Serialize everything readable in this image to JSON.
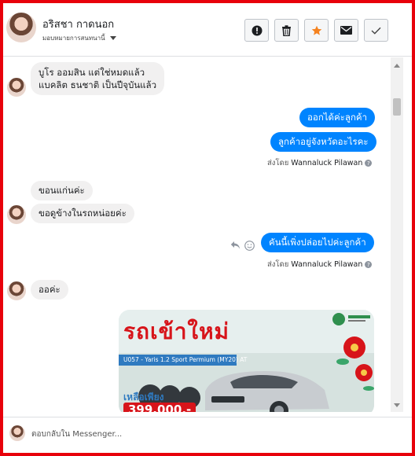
{
  "header": {
    "contact_name": "อริสชา กาดนอก",
    "assign_label": "มอบหมายการสนทนานี้",
    "tools": [
      "mark-spam",
      "delete",
      "star",
      "mark-unread",
      "done"
    ]
  },
  "messages": {
    "m1_line1": "บูโร ออมสิน แต่ใช่หมดแล้ว",
    "m1_line2": "แบคลิต ธนชาติ เป็นปีจุบันแล้ว",
    "m2": "ออกได้ค่ะลูกค้า",
    "m3": "ลูกค้าอยู่จังหวัดอะไรคะ",
    "sent_by_prefix": "ส่งโดย",
    "sent_by_name": "Wannaluck Pilawan",
    "m4": "ขอนแก่นค่ะ",
    "m5": "ขอดูข้างในรถหน่อยค่ะ",
    "m6": "คันนี้เพิ่งปล่อยไปค่ะลูกค้า",
    "m7": "ออค่ะ"
  },
  "car_promo": {
    "headline": "รถเข้าใหม่",
    "model": "U057 - Yaris 1.2 Sport Permium (MY20) AT",
    "price_label": "เหลือเพียง",
    "price": "399,000.-"
  },
  "footer": {
    "reply_placeholder": "ตอบกลับใน Messenger..."
  },
  "colors": {
    "frame": "#e8000b",
    "outgoing": "#0084ff",
    "incoming": "#f1f0f0",
    "promo_red": "#d7141a"
  }
}
